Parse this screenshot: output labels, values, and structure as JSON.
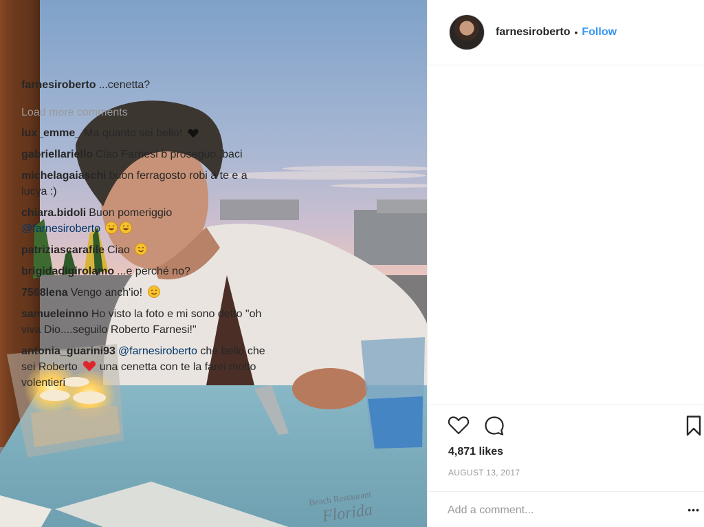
{
  "post": {
    "author": "farnesiroberto",
    "follow_label": "Follow",
    "separator": "•"
  },
  "caption": {
    "user": "farnesiroberto",
    "text": "...cenetta?"
  },
  "load_more": "Load more comments",
  "comments": [
    {
      "user": "lux_emme_",
      "text": "Ma quanto sei bello!"
    },
    {
      "user": "gabriellariello",
      "text": "Ciao Farnesi b proseguo..baci"
    },
    {
      "user": "michelagaiaschi",
      "text": "buon ferragosto robi a te e a lucya :)"
    },
    {
      "user": "chiara.bidoli",
      "text": "Buon pomeriggio",
      "mention": "@farnesiroberto"
    },
    {
      "user": "patriziascarafile",
      "text": "Ciao"
    },
    {
      "user": "brigidadigirolamo",
      "text": "...e perché no?"
    },
    {
      "user": "7568lena",
      "text": "Vengo anch'io!"
    },
    {
      "user": "samueleinno",
      "text": "Ho visto la foto e mi sono detto \"oh viva Dio....seguilo Roberto Farnesi!\""
    },
    {
      "user": "antonia_guarini93",
      "mention": "@farnesiroberto",
      "text_a": "che bello che sei Roberto",
      "text_b": "una cenetta con te la farei molto volentieri"
    }
  ],
  "likes": "4,871 likes",
  "date": "AUGUST 13, 2017",
  "add_comment_placeholder": "Add a comment...",
  "more_label": "•••",
  "photo_sign": {
    "line1": "Beach Restaurant",
    "line2": "Florida"
  },
  "icons": {
    "like": "heart-outline-icon",
    "comment": "speech-bubble-icon",
    "save": "bookmark-icon",
    "emojis": [
      "black-heart",
      "grinning-face",
      "smiling-face",
      "red-heart"
    ]
  },
  "colors": {
    "link": "#3897f0",
    "mention": "#003569",
    "muted": "#999999",
    "text": "#262626"
  }
}
